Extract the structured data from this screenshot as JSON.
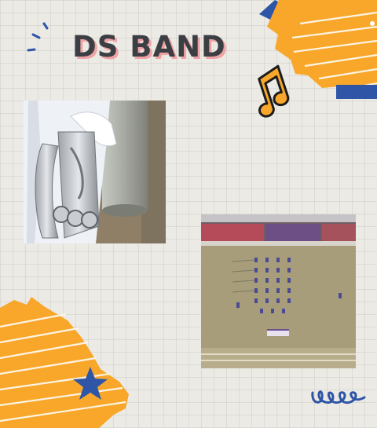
{
  "poster": {
    "title": "DS BAND"
  },
  "photos": {
    "left_alt": "euphonium-player-photo",
    "right_alt": "marching-band-formation-photo"
  },
  "decorations": {
    "icons": [
      "music-note-icon",
      "star-icon",
      "squiggle-icon",
      "sparkle-lines-icon"
    ]
  },
  "colors": {
    "background": "#eceae4",
    "orange": "#f8a72a",
    "blue": "#2f55a7",
    "title_text": "#3b3f44",
    "title_shadow": "#f0a3a6"
  }
}
